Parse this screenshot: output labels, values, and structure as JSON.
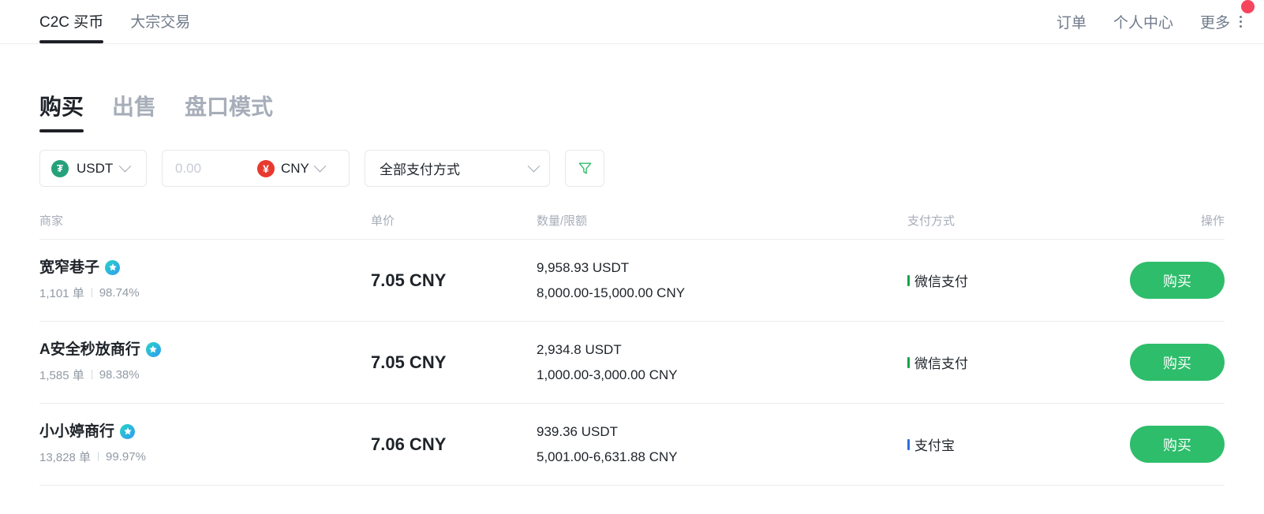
{
  "topnav": {
    "left_items": [
      {
        "label": "C2C 买币",
        "active": true
      },
      {
        "label": "大宗交易",
        "active": false
      }
    ],
    "right_items": [
      {
        "label": "订单"
      },
      {
        "label": "个人中心"
      },
      {
        "label": "更多"
      }
    ],
    "more_icon": "kebab-menu-icon",
    "notification_badge_color": "#f6465d"
  },
  "subtabs": [
    {
      "label": "购买",
      "active": true
    },
    {
      "label": "出售",
      "active": false
    },
    {
      "label": "盘口模式",
      "active": false
    }
  ],
  "filters": {
    "coin": {
      "symbol": "USDT",
      "badge_text": "₮",
      "badge_color": "#26a17b",
      "icon": "chevron-down-icon"
    },
    "amount": {
      "value": "",
      "placeholder": "0.00"
    },
    "fiat": {
      "symbol": "CNY",
      "badge_text": "¥",
      "badge_color": "#e8392f",
      "icon": "chevron-down-icon"
    },
    "payment": {
      "label": "全部支付方式",
      "icon": "chevron-down-icon"
    },
    "filter_button": {
      "icon": "funnel-icon"
    }
  },
  "table": {
    "headers": {
      "merchant": "商家",
      "price": "单价",
      "amount": "数量/限额",
      "payment": "支付方式",
      "action": "操作"
    },
    "rows": [
      {
        "merchant": "宽窄巷子",
        "verified": true,
        "orders": "1,101 单",
        "completion": "98.74%",
        "price": "7.05 CNY",
        "available": "9,958.93 USDT",
        "limit": "8,000.00-15,000.00 CNY",
        "payment": "微信支付",
        "payment_color": "#17a34a",
        "action_label": "购买"
      },
      {
        "merchant": "A安全秒放商行",
        "verified": true,
        "orders": "1,585 单",
        "completion": "98.38%",
        "price": "7.05 CNY",
        "available": "2,934.8 USDT",
        "limit": "1,000.00-3,000.00 CNY",
        "payment": "微信支付",
        "payment_color": "#17a34a",
        "action_label": "购买"
      },
      {
        "merchant": "小小婷商行",
        "verified": true,
        "orders": "13,828 单",
        "completion": "99.97%",
        "price": "7.06 CNY",
        "available": "939.36 USDT",
        "limit": "5,001.00-6,631.88 CNY",
        "payment": "支付宝",
        "payment_color": "#2f6fe0",
        "action_label": "购买"
      }
    ]
  }
}
